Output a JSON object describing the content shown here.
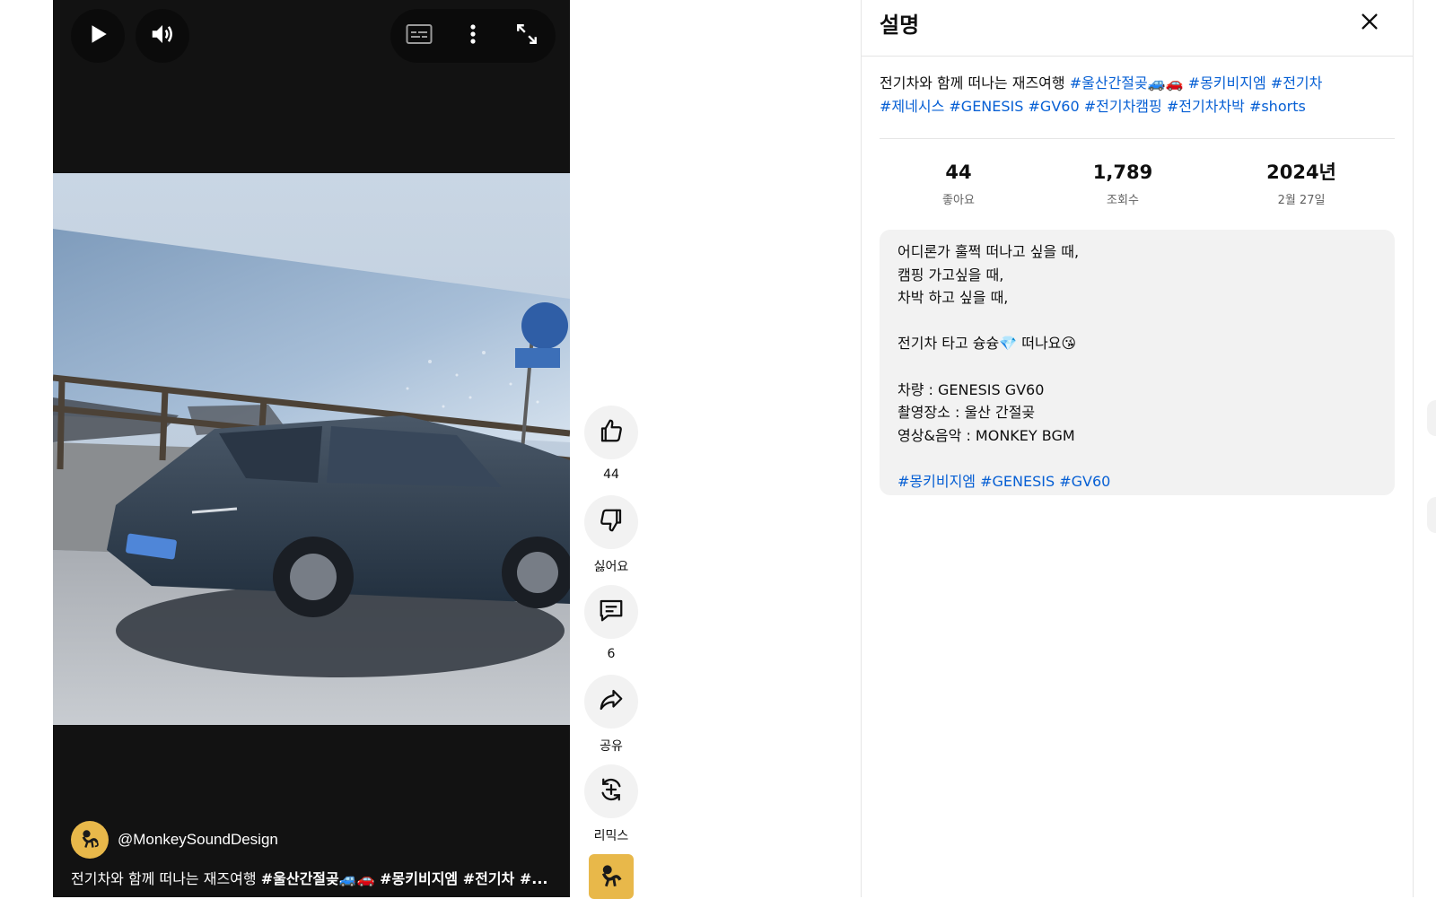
{
  "player": {
    "play_icon": "play-icon",
    "volume_icon": "volume-icon",
    "captions_icon": "captions-icon",
    "more_icon": "more-vert-icon",
    "fullscreen_icon": "fullscreen-icon",
    "channel_handle": "@MonkeySoundDesign",
    "title_text": "전기차와 함께 떠나는 재즈여행 ",
    "title_tags": "#울산간절곶🚙🚗 #몽키비지엠 #전기차 #..."
  },
  "actions": {
    "like_count": "44",
    "dislike_label": "싫어요",
    "comments_count": "6",
    "share_label": "공유",
    "remix_label": "리믹스"
  },
  "panel": {
    "title": "설명",
    "close_icon": "close-icon",
    "summary_text": "전기차와 함께 떠나는 재즈여행 ",
    "summary_tags": [
      "#울산간절곶🚙🚗",
      "#몽키비지엠",
      "#전기차",
      "#제네시스",
      "#GENESIS",
      "#GV60",
      "#전기차캠핑",
      "#전기차차박",
      "#shorts"
    ],
    "stats": {
      "likes_value": "44",
      "likes_label": "좋아요",
      "views_value": "1,789",
      "views_label": "조회수",
      "year_value": "2024년",
      "date_label": "2월 27일"
    },
    "description_lines": [
      "어디론가 훌쩍 떠나고 싶을 때,",
      "캠핑 가고싶을 때,",
      "차박 하고 싶을 때,",
      "",
      "전기차 타고 슝슝💎 떠나요😘",
      "",
      "차량 : GENESIS GV60",
      "촬영장소 : 울산 간절곶",
      "영상&음악 : MONKEY BGM",
      ""
    ],
    "description_tags": [
      "#몽키비지엠",
      "#GENESIS",
      "#GV60"
    ]
  },
  "colors": {
    "hashtag": "#065fd4",
    "player_bg": "#121212",
    "button_bg": "#f2f2f2",
    "avatar_bg": "#e8b84a"
  }
}
